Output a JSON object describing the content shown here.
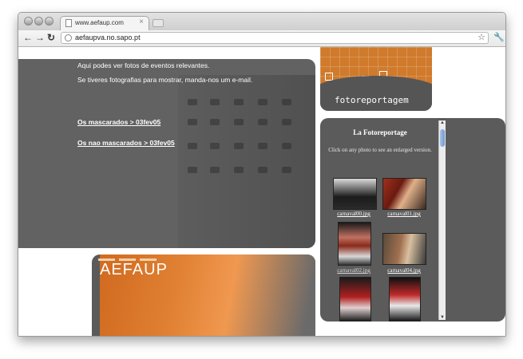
{
  "browser": {
    "tab_title": "www.aefaup.com",
    "tab_close": "×",
    "url": "aefaupva.no.sapo.pt",
    "back_icon": "back-arrow-icon",
    "forward_icon": "forward-arrow-icon",
    "reload_icon": "reload-icon",
    "bookmark_icon": "star-icon",
    "menu_icon": "wrench-icon"
  },
  "intro": {
    "line1": "Aqui podes ver fotos de eventos relevantes.",
    "line2": "Se tiveres fotografias para mostrar, manda-nos um e-mail."
  },
  "links": [
    {
      "label": "Os mascarados > 03fev05"
    },
    {
      "label": "Os nao mascarados > 03fev05"
    }
  ],
  "banner": {
    "logo_text": "AEFAUP"
  },
  "fotoreportagem": {
    "label": "fotoreportagem"
  },
  "gallery": {
    "title": "La Fotoreportage",
    "subtitle": "Click on any photo to see an enlarged version.",
    "photos": [
      {
        "caption": "carnaval00.jpg"
      },
      {
        "caption": "carnaval01.jpg"
      },
      {
        "caption": "carnaval02.jpg"
      },
      {
        "caption": "carnaval04.jpg"
      },
      {
        "caption": ""
      },
      {
        "caption": ""
      }
    ]
  },
  "colors": {
    "panel_gray": "#626262",
    "accent_orange": "#d07a2c",
    "link_white": "#ffffff"
  }
}
